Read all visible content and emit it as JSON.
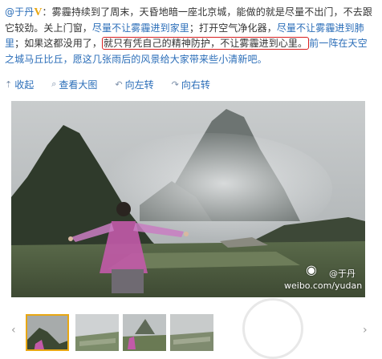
{
  "post": {
    "author": "@于丹",
    "badge": "V",
    "seg1": "：雾霾持续到了周末，天昏地暗一座北京城，能做的就是尽量不出门，不去跟它较劲。关上门窗，",
    "seg2": "尽量不让雾霾进到家里",
    "seg3": "；打开空气净化器，",
    "seg4": "尽量不让雾霾进到肺里",
    "seg5": "；如果这都没用了，",
    "seg6": "就只有凭自己的精神防护，不让雾霾进到心里。",
    "seg7": "前一阵在天空之城马丘比丘，愿这几张雨后的风景给大家带来些小清新吧。"
  },
  "toolbar": {
    "collapse": "收起",
    "view_large": "查看大图",
    "rotate_left": "向左转",
    "rotate_right": "向右转"
  },
  "watermark": {
    "handle": "@于丹",
    "url": "weibo.com/yudan"
  },
  "thumbnails": {
    "count": 4,
    "active_index": 0
  },
  "colors": {
    "link": "#2a6db8",
    "highlight_box": "#d81e1e",
    "badge": "#e8a713"
  },
  "icons": {
    "collapse": "arrow-up-icon",
    "view_large": "magnifier-icon",
    "rotate_left": "rotate-left-icon",
    "rotate_right": "rotate-right-icon",
    "prev": "chevron-left-icon",
    "next": "chevron-right-icon",
    "weibo": "weibo-logo-icon"
  }
}
